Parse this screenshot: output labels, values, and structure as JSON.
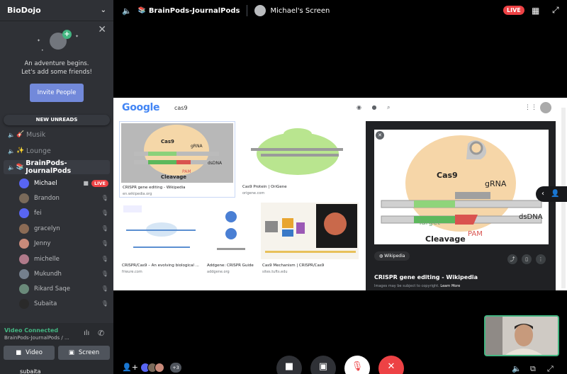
{
  "server": {
    "name": "BioDojo"
  },
  "friend_prompt": {
    "line1": "An adventure begins.",
    "line2": "Let's add some friends!",
    "invite_label": "Invite People"
  },
  "new_unreads": "NEW UNREADS",
  "channels": [
    {
      "emoji": "🎸",
      "name": "Musik"
    },
    {
      "emoji": "✨",
      "name": "Lounge"
    },
    {
      "emoji": "📚",
      "name": "BrainPods-JournalPods"
    }
  ],
  "users": [
    {
      "name": "Michael",
      "live": "LIVE",
      "color": "#5865f2"
    },
    {
      "name": "Brandon",
      "color": "#7a6a5a"
    },
    {
      "name": "fei",
      "color": "#5865f2"
    },
    {
      "name": "gracelyn",
      "color": "#8b6b55"
    },
    {
      "name": "Jenny",
      "color": "#c98a7a"
    },
    {
      "name": "michelle",
      "color": "#b07a8a"
    },
    {
      "name": "Mukundh",
      "color": "#747f8d"
    },
    {
      "name": "Rikard Saqe",
      "color": "#6a8a7a"
    },
    {
      "name": "Subaita",
      "color": "#2a2a2a"
    }
  ],
  "voice": {
    "status": "Video Connected",
    "channel": "BrainPods-JournalPods / ...",
    "video_label": "Video",
    "screen_label": "Screen",
    "current_user": "subaita"
  },
  "topbar": {
    "channel_title": "BrainPods-JournalPods",
    "screen_title": "Michael's Screen",
    "live": "LIVE"
  },
  "stream": {
    "logo": "Google",
    "query": "cas9",
    "results": [
      {
        "caption": "CRISPR gene editing - Wikipedia",
        "source": "en.wikipedia.org"
      },
      {
        "caption": "Cas9 Protein | OriGene",
        "source": "origene.com"
      },
      {
        "caption": "CRISPR/Cas9 – An evolving biological ...",
        "source": "frieure.com"
      },
      {
        "caption": "Addgene: CRISPR Guide",
        "source": "addgene.org"
      },
      {
        "caption": "Cas9 Mechanism | CRISPR/Cas9",
        "source": "sites.tufts.edu"
      }
    ],
    "panel": {
      "wiki_chip": "Wikipedia",
      "title": "CRISPR gene editing - Wikipedia",
      "note": "Images may be subject to copyright.",
      "learn_more": "Learn More",
      "diagram": {
        "cas9": "Cas9",
        "grna": "gRNA",
        "target": "Target",
        "dsdna": "dsDNA",
        "pam": "PAM",
        "cleavage": "Cleavage"
      }
    }
  },
  "bottombar": {
    "more_count": "+3"
  },
  "colors": {
    "sidebar_bg": "#2f3136",
    "accent": "#7289da",
    "live": "#ed4245",
    "connected": "#43b581",
    "leave": "#ed4245"
  }
}
